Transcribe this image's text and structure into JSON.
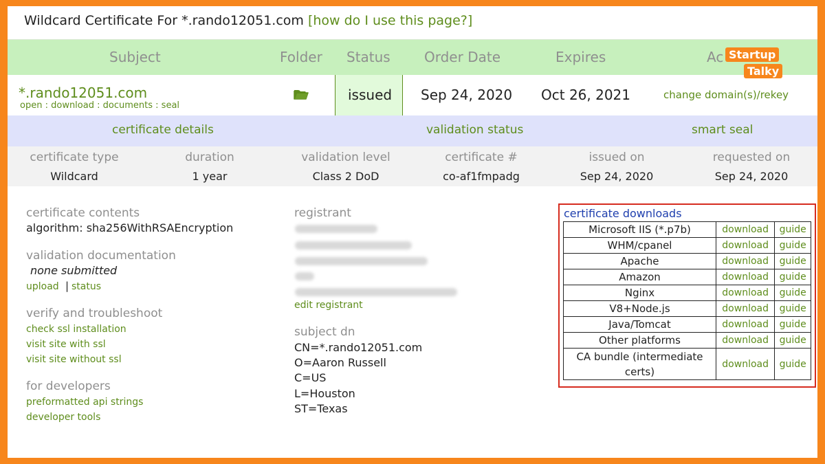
{
  "title": {
    "text": "Wildcard Certificate For *.rando12051.com",
    "help_link": "[how do I use this page?]"
  },
  "header": {
    "subject": "Subject",
    "folder": "Folder",
    "status": "Status",
    "order_date": "Order Date",
    "expires": "Expires",
    "actions": "Ac"
  },
  "row": {
    "domain": "*.rando12051.com",
    "links": [
      "open",
      "download",
      "documents",
      "seal"
    ],
    "status": "issued",
    "order_date": "Sep 24, 2020",
    "expires": "Oct 26, 2021",
    "action": "change domain(s)/rekey"
  },
  "section_bar": {
    "certificate_details": "certificate details",
    "validation_status": "validation status",
    "smart_seal": "smart seal"
  },
  "details": [
    {
      "label": "certificate type",
      "value": "Wildcard"
    },
    {
      "label": "duration",
      "value": "1 year"
    },
    {
      "label": "validation level",
      "value": "Class 2 DoD"
    },
    {
      "label": "certificate #",
      "value": "co-af1fmpadg"
    },
    {
      "label": "issued on",
      "value": "Sep 24, 2020"
    },
    {
      "label": "requested on",
      "value": "Sep 24, 2020"
    }
  ],
  "left": {
    "contents_heading": "certificate contents",
    "algorithm": "algorithm:  sha256WithRSAEncryption",
    "validation_heading": "validation documentation",
    "validation_value": "none submitted",
    "upload": "upload",
    "status": "status",
    "verify_heading": "verify and troubleshoot",
    "verify_links": [
      "check ssl installation",
      "visit site with ssl",
      "visit site without ssl"
    ],
    "dev_heading": "for developers",
    "dev_links": [
      "preformatted api strings",
      "developer tools"
    ]
  },
  "middle": {
    "registrant_heading": "registrant",
    "edit_registrant": "edit registrant",
    "subject_heading": "subject dn",
    "subject_lines": [
      "CN=*.rando12051.com",
      "O=Aaron Russell",
      "C=US",
      "L=Houston",
      "ST=Texas"
    ]
  },
  "downloads": {
    "title": "certificate downloads",
    "download_label": "download",
    "guide_label": "guide",
    "items": [
      "Microsoft IIS (*.p7b)",
      "WHM/cpanel",
      "Apache",
      "Amazon",
      "Nginx",
      "V8+Node.js",
      "Java/Tomcat",
      "Other platforms",
      "CA bundle (intermediate certs)"
    ]
  },
  "watermark": {
    "line1": "Startup",
    "line2": "Talky"
  },
  "colors": {
    "accent_green": "#5e8d1c",
    "header_bg": "#c7f0bd",
    "border_orange": "#f7861c",
    "highlight_red": "#d62b1e"
  }
}
